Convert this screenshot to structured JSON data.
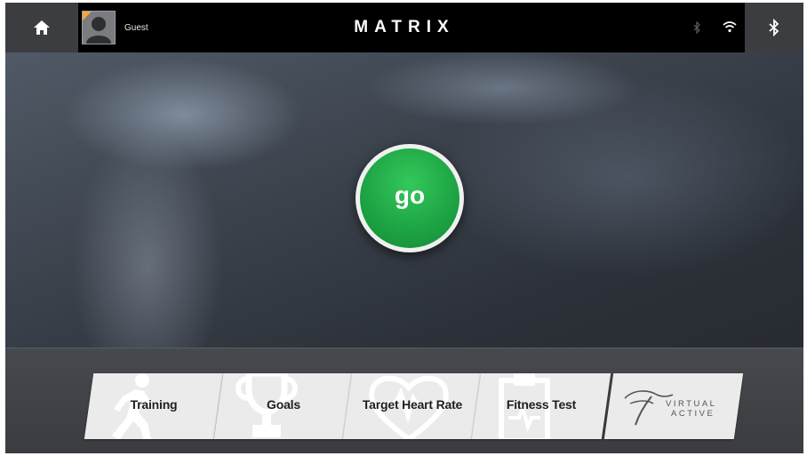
{
  "topbar": {
    "home_icon": "home-icon",
    "user_name": "Guest",
    "brand": "MATRIX",
    "status_bluetooth_icon": "bluetooth-icon",
    "status_wifi_icon": "wifi-icon",
    "bluetooth_button_icon": "bluetooth-icon"
  },
  "main": {
    "go_label": "go",
    "go_color": "#1ea545"
  },
  "tiles": [
    {
      "label": "Training",
      "icon": "runner-icon"
    },
    {
      "label": "Goals",
      "icon": "trophy-icon"
    },
    {
      "label": "Target Heart Rate",
      "icon": "heart-icon"
    },
    {
      "label": "Fitness Test",
      "icon": "clipboard-icon"
    },
    {
      "label_line1": "VIRTUAL",
      "label_line2": "ACTIVE",
      "icon": "virtual-active-logo"
    }
  ]
}
